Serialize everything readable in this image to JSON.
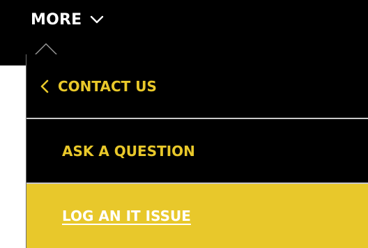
{
  "header": {
    "more_label": "MORE"
  },
  "menu": {
    "back_label": "CONTACT US",
    "items": [
      {
        "label": "ASK A QUESTION"
      },
      {
        "label": "LOG AN IT ISSUE"
      }
    ]
  },
  "colors": {
    "bar_background": "#000000",
    "accent_yellow": "#e8c82b",
    "text_white": "#ffffff"
  },
  "icons": {
    "more_chevron": "chevron-down-icon",
    "back_chevron": "chevron-left-icon"
  }
}
